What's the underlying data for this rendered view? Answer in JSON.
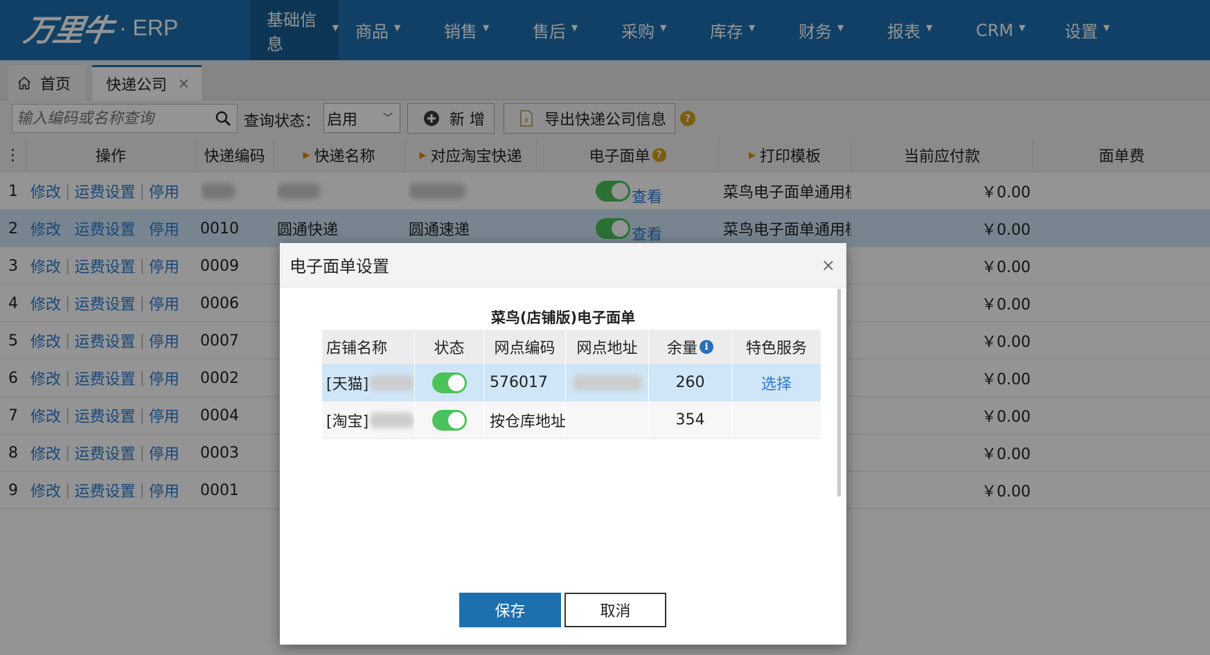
{
  "app": {
    "logo_mark": "万里牛",
    "logo_text": "· ERP"
  },
  "nav": [
    "基础信息",
    "商品",
    "销售",
    "售后",
    "采购",
    "库存",
    "财务",
    "报表",
    "CRM",
    "设置"
  ],
  "tabs": {
    "home": "首页",
    "active": "快递公司"
  },
  "toolbar": {
    "search_placeholder": "输入编码或名称查询",
    "status_label": "查询状态：",
    "status_value": "启用",
    "add_label": "新 增",
    "export_label": "导出快递公司信息"
  },
  "grid": {
    "headers": [
      "操作",
      "快递编码",
      "快递名称",
      "对应淘宝快递",
      "电子面单",
      "打印模板",
      "当前应付款",
      "面单费"
    ],
    "ops": {
      "edit": "修改",
      "fee": "运费设置",
      "disable": "停用"
    },
    "view_label": "查看",
    "rows": [
      {
        "no": "1",
        "code": "",
        "name": "",
        "tb": "",
        "template": "菜鸟电子面单通用模",
        "pay": "￥0.00"
      },
      {
        "no": "2",
        "code": "0010",
        "name": "圆通快递",
        "tb": "圆通速递",
        "template": "菜鸟电子面单通用模",
        "pay": "￥0.00"
      },
      {
        "no": "3",
        "code": "0009",
        "name": "",
        "tb": "",
        "template": "",
        "pay": "￥0.00"
      },
      {
        "no": "4",
        "code": "0006",
        "name": "",
        "tb": "",
        "template": "",
        "pay": "￥0.00"
      },
      {
        "no": "5",
        "code": "0007",
        "name": "",
        "tb": "",
        "template": "",
        "pay": "￥0.00"
      },
      {
        "no": "6",
        "code": "0002",
        "name": "",
        "tb": "",
        "template": "",
        "pay": "￥0.00"
      },
      {
        "no": "7",
        "code": "0004",
        "name": "",
        "tb": "",
        "template": "",
        "pay": "￥0.00"
      },
      {
        "no": "8",
        "code": "0003",
        "name": "",
        "tb": "",
        "template": "",
        "pay": "￥0.00"
      },
      {
        "no": "9",
        "code": "0001",
        "name": "",
        "tb": "",
        "template": "",
        "pay": "￥0.00"
      }
    ]
  },
  "modal": {
    "title": "电子面单设置",
    "close": "×",
    "subtitle": "菜鸟(店铺版)电子面单",
    "headers": [
      "店铺名称",
      "状态",
      "网点编码",
      "网点地址",
      "余量",
      "特色服务"
    ],
    "rows": [
      {
        "shop": "[天猫]",
        "code": "576017",
        "address": "",
        "balance": "260",
        "service": "选择"
      },
      {
        "shop": "[淘宝]",
        "code": "按仓库地址l",
        "address": "",
        "balance": "354",
        "service": ""
      }
    ],
    "save": "保存",
    "cancel": "取消"
  },
  "colors": {
    "primary": "#1d6fae",
    "link": "#2a7bd2",
    "toggle_on": "#4cc25a",
    "help": "#d4a017"
  }
}
